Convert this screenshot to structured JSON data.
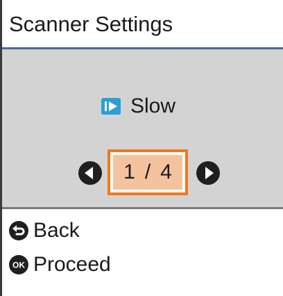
{
  "header": {
    "title": "Scanner Settings"
  },
  "setting": {
    "icon": "play-mode-icon",
    "value": "Slow"
  },
  "pager": {
    "current": "1",
    "separator": "/",
    "total": "4",
    "prev_icon": "arrow-left-icon",
    "next_icon": "arrow-right-icon"
  },
  "softkeys": {
    "back": {
      "icon": "back-icon",
      "label": "Back"
    },
    "proceed": {
      "icon": "ok-icon",
      "label": "Proceed",
      "icon_text": "OK"
    }
  },
  "colors": {
    "panel_background": "#d3d3d3",
    "highlight_border": "#f0781e",
    "highlight_fill": "#f4c39e",
    "mode_icon_blue": "#2a9fd8",
    "title_rule": "#4a6a9a"
  }
}
